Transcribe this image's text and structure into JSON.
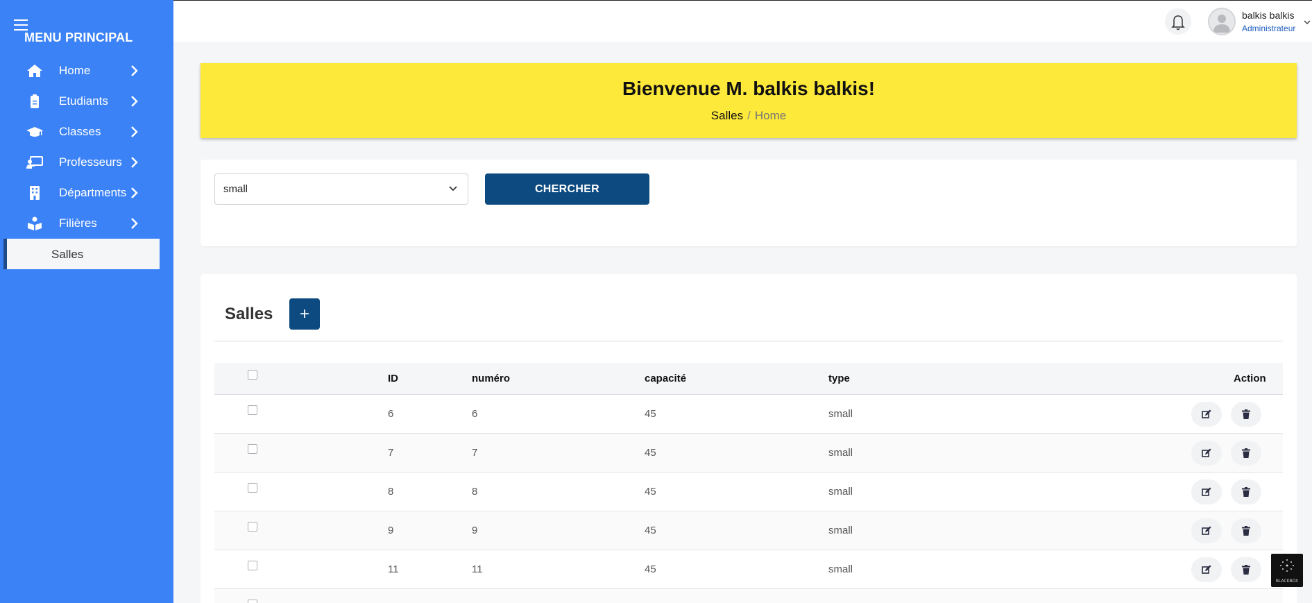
{
  "sidebar": {
    "title": "MENU PRINCIPAL",
    "items": [
      {
        "label": "Home",
        "icon": "home-icon"
      },
      {
        "label": "Etudiants",
        "icon": "clipboard-icon"
      },
      {
        "label": "Classes",
        "icon": "graduation-cap-icon"
      },
      {
        "label": "Professeurs",
        "icon": "teacher-icon"
      },
      {
        "label": "Départments",
        "icon": "building-icon"
      },
      {
        "label": "Filières",
        "icon": "reader-icon"
      }
    ],
    "active_item": "Salles"
  },
  "topbar": {
    "user_name": "balkis balkis",
    "user_role": "Administrateur"
  },
  "banner": {
    "title": "Bienvenue M. balkis balkis!",
    "breadcrumb_current": "Salles",
    "breadcrumb_home": "Home"
  },
  "search": {
    "select_value": "small",
    "button_label": "CHERCHER"
  },
  "table": {
    "title": "Salles",
    "add_label": "+",
    "columns": {
      "id": "ID",
      "numero": "numéro",
      "capacite": "capacité",
      "type": "type",
      "action": "Action"
    },
    "rows": [
      {
        "id": "6",
        "numero": "6",
        "capacite": "45",
        "type": "small"
      },
      {
        "id": "7",
        "numero": "7",
        "capacite": "45",
        "type": "small"
      },
      {
        "id": "8",
        "numero": "8",
        "capacite": "45",
        "type": "small"
      },
      {
        "id": "9",
        "numero": "9",
        "capacite": "45",
        "type": "small"
      },
      {
        "id": "11",
        "numero": "11",
        "capacite": "45",
        "type": "small"
      }
    ]
  },
  "watermark": {
    "label": "BLACKBOX"
  },
  "colors": {
    "sidebar": "#3b82f6",
    "banner": "#fde93a",
    "primary_button": "#0c4a80"
  }
}
